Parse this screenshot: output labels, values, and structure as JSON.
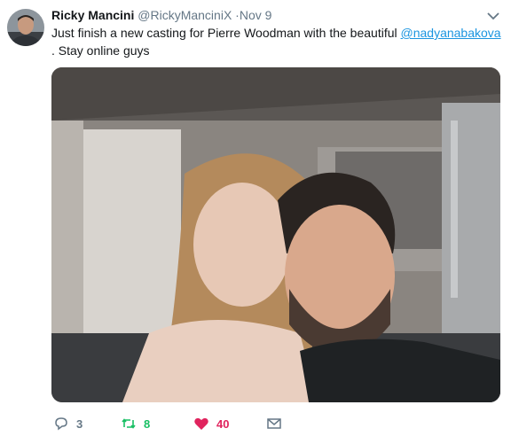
{
  "tweet": {
    "author_name": "Ricky Mancini",
    "author_handle": "@RickyManciniX",
    "date_separator": "·",
    "date": "Nov 9",
    "text_before_mention": "Just finish a new casting for Pierre Woodman with the beautiful ",
    "mention": "@nadyanabakova",
    "text_after_mention": ". Stay online guys",
    "photo_alt": "Selfie of a woman and a man posing cheek to cheek indoors"
  },
  "actions": {
    "reply_count": "3",
    "retweet_count": "8",
    "like_count": "40"
  },
  "colors": {
    "link": "#1b95e0",
    "muted": "#657786",
    "retweet": "#17bf63",
    "like": "#e0245e"
  },
  "icons": [
    "chevron-down-icon",
    "reply-icon",
    "retweet-icon",
    "heart-icon",
    "envelope-icon"
  ]
}
